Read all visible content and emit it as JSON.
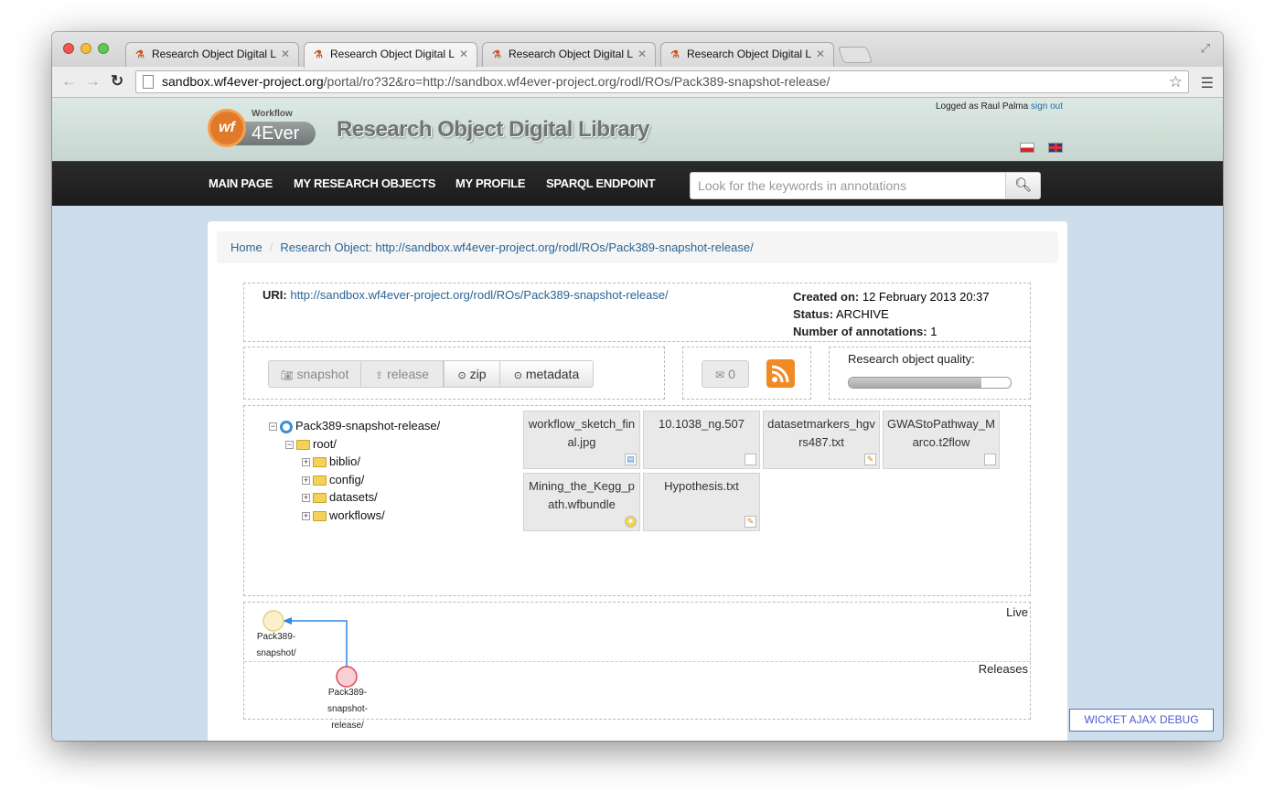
{
  "browser": {
    "tabs": [
      {
        "title": "Research Object Digital Lib",
        "active": false
      },
      {
        "title": "Research Object Digital Lib",
        "active": true
      },
      {
        "title": "Research Object Digital Lib",
        "active": false
      },
      {
        "title": "Research Object Digital Lib",
        "active": false
      }
    ],
    "url_host": "sandbox.wf4ever-project.org",
    "url_path": "/portal/ro?32&ro=http://sandbox.wf4ever-project.org/rodl/ROs/Pack389-snapshot-release/"
  },
  "header": {
    "logo_small": "Workflow",
    "logo_main": "4Ever",
    "logo_circle": "wf",
    "site_title": "Research Object Digital Library",
    "login_text": "Logged as Raul Palma",
    "signout": "sign out"
  },
  "nav": {
    "items": [
      "MAIN PAGE",
      "MY RESEARCH OBJECTS",
      "MY PROFILE",
      "SPARQL ENDPOINT"
    ],
    "search_placeholder": "Look for the keywords in annotations"
  },
  "breadcrumb": {
    "home": "Home",
    "current": "Research Object: http://sandbox.wf4ever-project.org/rodl/ROs/Pack389-snapshot-release/"
  },
  "info": {
    "uri_label": "URI:",
    "uri": "http://sandbox.wf4ever-project.org/rodl/ROs/Pack389-snapshot-release/",
    "created_label": "Created on:",
    "created": "12 February 2013 20:37",
    "status_label": "Status:",
    "status": "ARCHIVE",
    "annotations_label": "Number of annotations:",
    "annotations": "1"
  },
  "actions": {
    "snapshot": "snapshot",
    "release": "release",
    "zip": "zip",
    "metadata": "metadata",
    "messages_count": "0",
    "quality_label": "Research object quality:",
    "quality_fraction": 0.82
  },
  "tree": {
    "root_ro": "Pack389-snapshot-release/",
    "root_folder": "root/",
    "folders": [
      "biblio/",
      "config/",
      "datasets/",
      "workflows/"
    ]
  },
  "files": [
    {
      "name": "workflow_sketch_final.jpg",
      "icon": "image-icon"
    },
    {
      "name": "10.1038_ng.507",
      "icon": "file-icon"
    },
    {
      "name": "datasetmarkers_hgvrs487.txt",
      "icon": "text-file-icon"
    },
    {
      "name": "GWAStoPathway_Marco.t2flow",
      "icon": "file-icon"
    },
    {
      "name": "Mining_the_Kegg_path.wfbundle",
      "icon": "bundle-icon"
    },
    {
      "name": "Hypothesis.txt",
      "icon": "text-file-icon"
    }
  ],
  "evolution": {
    "live_label": "Live",
    "releases_label": "Releases",
    "snapshot_node": "Pack389-snapshot/",
    "release_node": "Pack389-snapshot-release/"
  },
  "debug_label": "WICKET AJAX DEBUG"
}
